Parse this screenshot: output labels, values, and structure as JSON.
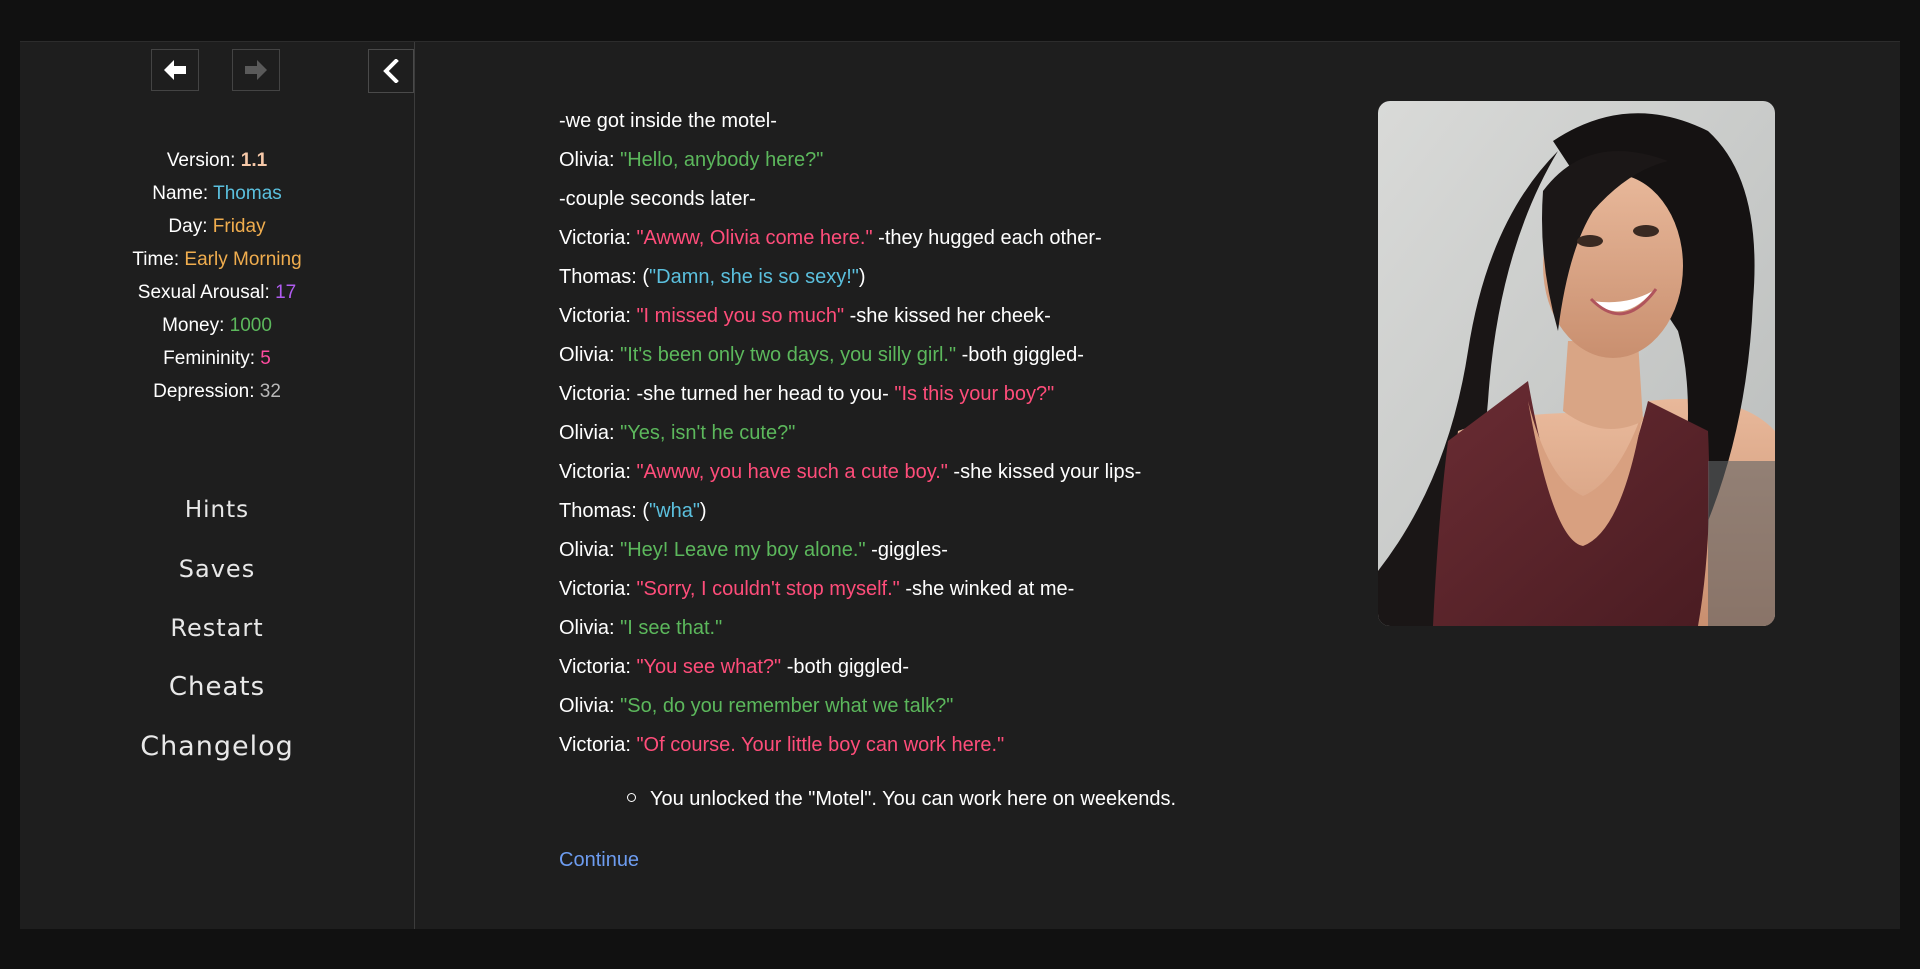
{
  "nav": {
    "back_icon": "arrow-left-icon",
    "forward_icon": "arrow-right-icon",
    "collapse_icon": "chevron-left-icon"
  },
  "stats": {
    "version_label": "Version:",
    "version_value": "1.1",
    "name_label": "Name:",
    "name_value": "Thomas",
    "day_label": "Day:",
    "day_value": "Friday",
    "time_label": "Time:",
    "time_value": "Early Morning",
    "arousal_label": "Sexual Arousal:",
    "arousal_value": "17",
    "money_label": "Money:",
    "money_value": "1000",
    "femininity_label": "Femininity:",
    "femininity_value": "5",
    "depression_label": "Depression:",
    "depression_value": "32"
  },
  "menu": {
    "hints": "Hints",
    "saves": "Saves",
    "restart": "Restart",
    "cheats": "Cheats",
    "changelog": "Changelog"
  },
  "story": [
    {
      "speaker": "",
      "quote": "",
      "after": "-we got inside the motel-"
    },
    {
      "speaker": "Olivia:",
      "quote": "\"Hello, anybody here?\"",
      "after": ""
    },
    {
      "speaker": "",
      "quote": "",
      "after": "-couple seconds later-"
    },
    {
      "speaker": "Victoria:",
      "quote": "\"Awww, Olivia come here.\"",
      "after": "-they hugged each other-"
    },
    {
      "speaker": "Thomas: (",
      "quote": "\"Damn, she is so sexy!\"",
      "after": ")"
    },
    {
      "speaker": "Victoria:",
      "quote": "\"I missed you so much\"",
      "after": "-she kissed her cheek-"
    },
    {
      "speaker": "Olivia:",
      "quote": "\"It's been only two days, you silly girl.\"",
      "after": "-both giggled-"
    },
    {
      "speaker": "Victoria: -she turned her head to you-",
      "quote": "\"Is this your boy?\"",
      "after": ""
    },
    {
      "speaker": "Olivia:",
      "quote": "\"Yes, isn't he cute?\"",
      "after": ""
    },
    {
      "speaker": "Victoria:",
      "quote": "\"Awww, you have such a cute boy.\"",
      "after": "-she kissed your lips-"
    },
    {
      "speaker": "Thomas: (",
      "quote": "\"wha\"",
      "after": ")"
    },
    {
      "speaker": "Olivia:",
      "quote": "\"Hey! Leave my boy alone.\"",
      "after": "-giggles-"
    },
    {
      "speaker": "Victoria:",
      "quote": "\"Sorry, I couldn't stop myself.\"",
      "after": "-she winked at me-"
    },
    {
      "speaker": "Olivia:",
      "quote": "\"I see that.\"",
      "after": ""
    },
    {
      "speaker": "Victoria:",
      "quote": "\"You see what?\"",
      "after": "-both giggled-"
    },
    {
      "speaker": "Olivia:",
      "quote": "\"So, do you remember what we talk?\"",
      "after": ""
    },
    {
      "speaker": "Victoria:",
      "quote": "\"Of course. Your little boy can work here.\"",
      "after": ""
    }
  ],
  "unlock_text": "You unlocked the \"Motel\". You can work here on weekends.",
  "continue_label": "Continue",
  "colors": {
    "olivia": "#5cb85c",
    "victoria": "#ff4d7a",
    "thomas": "#5bc0de",
    "link": "#6d9cf0",
    "panel_bg": "#1e1e1e"
  }
}
